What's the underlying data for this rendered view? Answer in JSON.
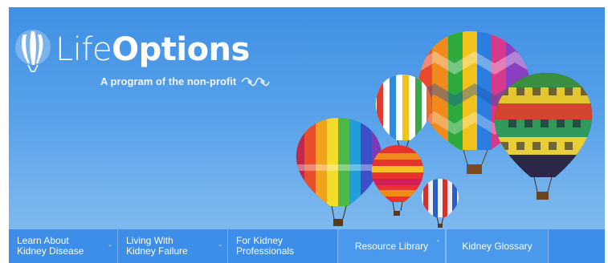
{
  "logo": {
    "name_light": "Life",
    "name_bold": "Options",
    "tagline": "A program of the non-profit"
  },
  "icons": {
    "logo_mark": "balloon-logo-icon",
    "org_swirl": "swirl-logo-icon",
    "caret": "chevron-down-icon"
  },
  "colors": {
    "sky_top": "#3f8fe4",
    "sky_bottom": "#86bdf0",
    "nav_bg": "#3d8ee8",
    "text": "#ffffff"
  },
  "nav": {
    "items": [
      {
        "line1": "Learn About",
        "line2": "Kidney Disease",
        "has_menu": true
      },
      {
        "line1": "Living With",
        "line2": "Kidney Failure",
        "has_menu": true
      },
      {
        "line1": "For Kidney",
        "line2": "Professionals",
        "has_menu": false
      },
      {
        "label": "Resource Library",
        "has_menu": true
      },
      {
        "label": "Kidney Glossary",
        "has_menu": false
      }
    ],
    "caret_glyph": "ˇ"
  }
}
